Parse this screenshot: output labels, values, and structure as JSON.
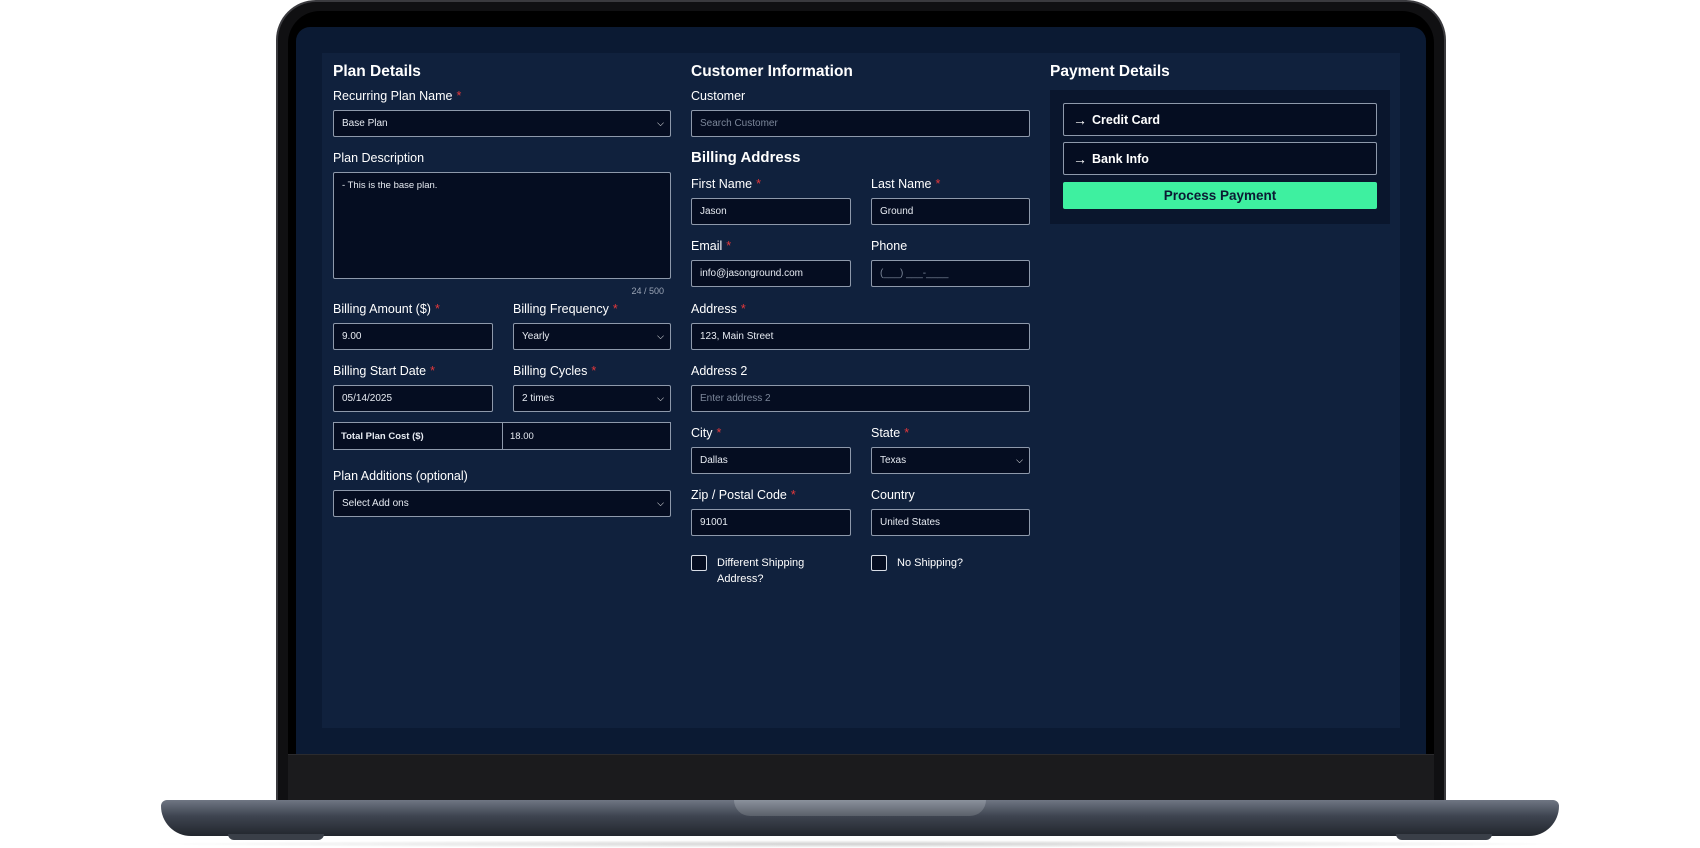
{
  "plan_details": {
    "title": "Plan Details",
    "recurring_plan_name_label": "Recurring Plan Name",
    "recurring_plan_name_value": "Base Plan",
    "plan_description_label": "Plan Description",
    "plan_description_value": "- This is the base plan.",
    "char_counter": "24 / 500",
    "billing_amount_label": "Billing Amount ($)",
    "billing_amount_value": "9.00",
    "billing_frequency_label": "Billing Frequency",
    "billing_frequency_value": "Yearly",
    "billing_start_date_label": "Billing Start Date",
    "billing_start_date_value": "05/14/2025",
    "billing_cycles_label": "Billing Cycles",
    "billing_cycles_value": "2 times",
    "total_plan_cost_label": "Total Plan Cost ($)",
    "total_plan_cost_value": "18.00",
    "plan_additions_label": "Plan Additions (optional)",
    "plan_additions_value": "Select Add ons"
  },
  "customer_information": {
    "title": "Customer Information",
    "customer_label": "Customer",
    "customer_placeholder": "Search Customer"
  },
  "billing_address": {
    "title": "Billing Address",
    "first_name_label": "First Name",
    "first_name_value": "Jason",
    "last_name_label": "Last Name",
    "last_name_value": "Ground",
    "email_label": "Email",
    "email_value": "info@jasonground.com",
    "phone_label": "Phone",
    "phone_placeholder": "(___) ___-____",
    "address_label": "Address",
    "address_value": "123, Main Street",
    "address2_label": "Address 2",
    "address2_placeholder": "Enter address 2",
    "city_label": "City",
    "city_value": "Dallas",
    "state_label": "State",
    "state_value": "Texas",
    "zip_label": "Zip / Postal Code",
    "zip_value": "91001",
    "country_label": "Country",
    "country_value": "United States",
    "different_shipping_label": "Different Shipping Address?",
    "no_shipping_label": "No Shipping?"
  },
  "payment_details": {
    "title": "Payment Details",
    "credit_card_label": "Credit Card",
    "bank_info_label": "Bank Info",
    "process_payment_label": "Process Payment"
  },
  "icons": {
    "required_marker": "*",
    "dropdown": "chevron-down-icon",
    "expand_arrow": "arrow-right-icon"
  },
  "colors": {
    "screen_bg": "#0b1a33",
    "panel_bg": "#10213d",
    "input_bg": "#050d21",
    "required": "#e5383b",
    "accent": "#3ef0a0"
  }
}
